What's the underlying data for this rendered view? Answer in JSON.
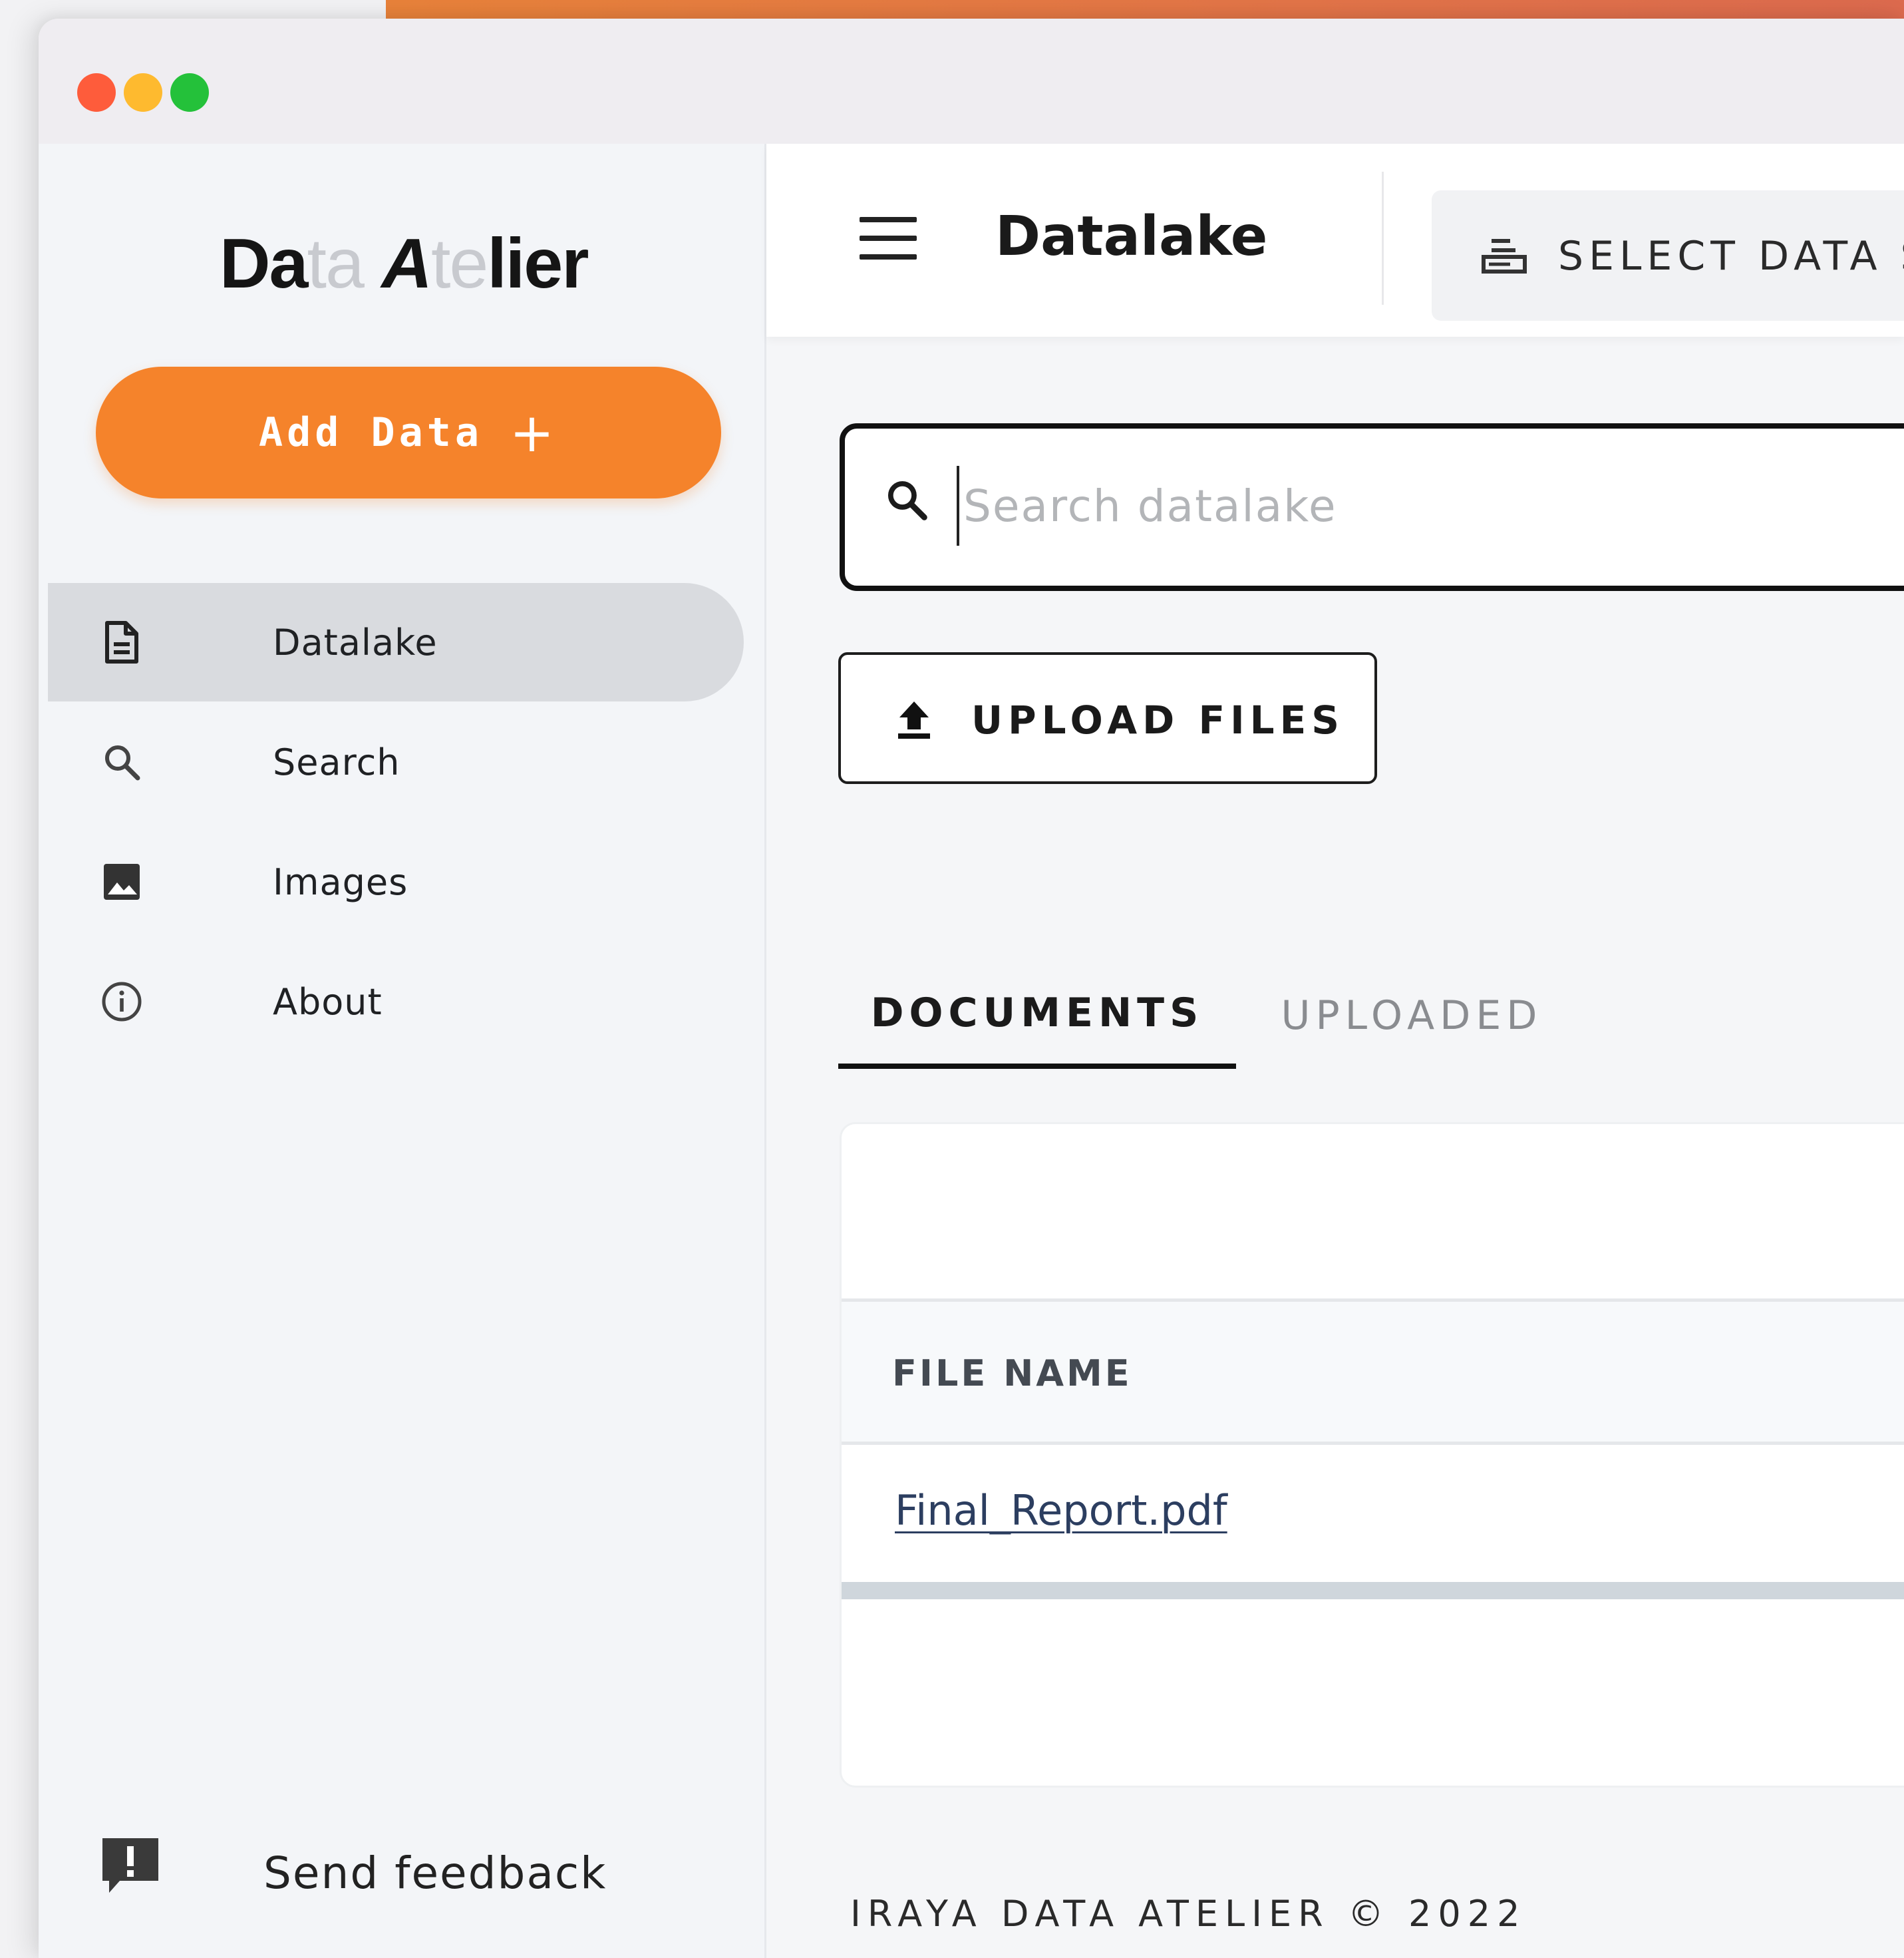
{
  "window": {
    "controls": [
      "close",
      "minimize",
      "maximize"
    ]
  },
  "sidebar": {
    "logo": {
      "parts": [
        {
          "text": "Da",
          "style": "bold"
        },
        {
          "text": "ta",
          "style": "faint"
        },
        {
          "text": " ",
          "style": "bold"
        },
        {
          "text": "A",
          "style": "italic"
        },
        {
          "text": "te",
          "style": "faint"
        },
        {
          "text": "lier",
          "style": "bold"
        }
      ]
    },
    "add_button": {
      "label": "Add Data",
      "icon": "plus-icon",
      "color": "#f5832b"
    },
    "items": [
      {
        "label": "Datalake",
        "icon": "document-icon",
        "active": true
      },
      {
        "label": "Search",
        "icon": "search-icon",
        "active": false
      },
      {
        "label": "Images",
        "icon": "image-icon",
        "active": false
      },
      {
        "label": "About",
        "icon": "info-icon",
        "active": false
      }
    ],
    "feedback": {
      "label": "Send feedback",
      "icon": "feedback-icon"
    }
  },
  "header": {
    "title": "Datalake",
    "select_source_label": "SELECT DATA SOURCE"
  },
  "search": {
    "placeholder": "Search datalake",
    "value": ""
  },
  "upload": {
    "label": "UPLOAD FILES"
  },
  "tabs": [
    {
      "label": "DOCUMENTS",
      "active": true
    },
    {
      "label": "UPLOADED",
      "active": false
    }
  ],
  "table": {
    "columns": [
      "FILE NAME"
    ],
    "rows": [
      {
        "file_name": "Final_Report.pdf"
      }
    ]
  },
  "footer": {
    "text": "IRAYA DATA ATELIER © 2022"
  },
  "colors": {
    "accent": "#f5832b",
    "close": "#fe5c3b",
    "minimize": "#feba2f",
    "maximize": "#24c13a"
  }
}
